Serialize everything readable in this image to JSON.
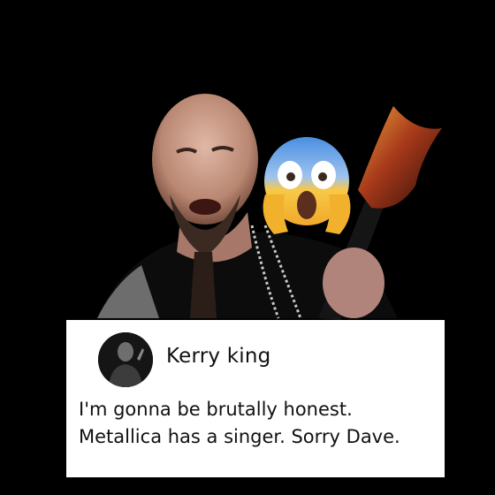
{
  "post": {
    "author_name": "Kerry king",
    "text_lines": [
      "I'm gonna be brutally honest.",
      "Metallica has a singer. Sorry Dave."
    ]
  },
  "icons": {
    "reaction_emoji": "face-screaming-in-fear-icon"
  },
  "colors": {
    "background": "#000000",
    "card": "#ffffff",
    "text": "#111111",
    "emoji_yellow": "#f7b627",
    "emoji_blue": "#4a8fe0"
  }
}
